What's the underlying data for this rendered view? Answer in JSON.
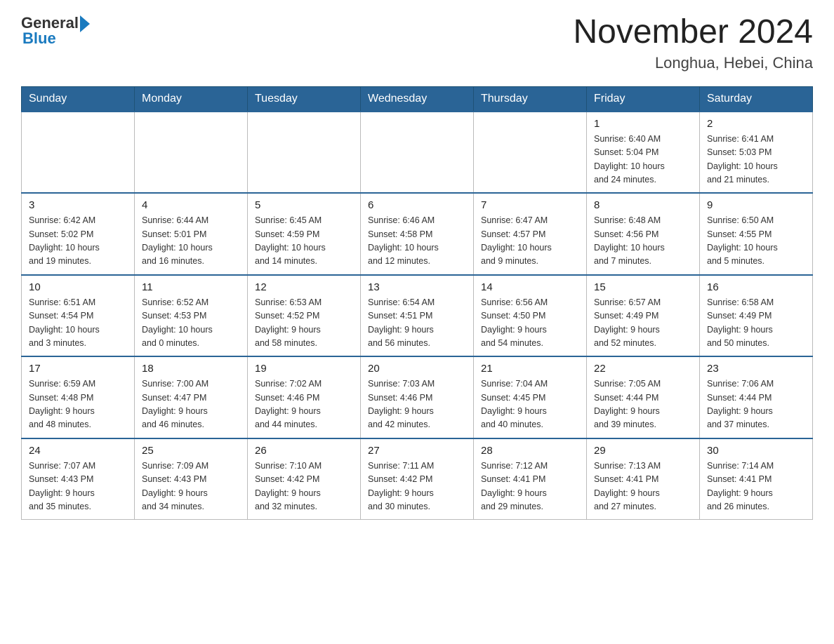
{
  "header": {
    "logo_general": "General",
    "logo_blue": "Blue",
    "month_title": "November 2024",
    "location": "Longhua, Hebei, China"
  },
  "weekdays": [
    "Sunday",
    "Monday",
    "Tuesday",
    "Wednesday",
    "Thursday",
    "Friday",
    "Saturday"
  ],
  "weeks": [
    [
      {
        "day": "",
        "info": ""
      },
      {
        "day": "",
        "info": ""
      },
      {
        "day": "",
        "info": ""
      },
      {
        "day": "",
        "info": ""
      },
      {
        "day": "",
        "info": ""
      },
      {
        "day": "1",
        "info": "Sunrise: 6:40 AM\nSunset: 5:04 PM\nDaylight: 10 hours\nand 24 minutes."
      },
      {
        "day": "2",
        "info": "Sunrise: 6:41 AM\nSunset: 5:03 PM\nDaylight: 10 hours\nand 21 minutes."
      }
    ],
    [
      {
        "day": "3",
        "info": "Sunrise: 6:42 AM\nSunset: 5:02 PM\nDaylight: 10 hours\nand 19 minutes."
      },
      {
        "day": "4",
        "info": "Sunrise: 6:44 AM\nSunset: 5:01 PM\nDaylight: 10 hours\nand 16 minutes."
      },
      {
        "day": "5",
        "info": "Sunrise: 6:45 AM\nSunset: 4:59 PM\nDaylight: 10 hours\nand 14 minutes."
      },
      {
        "day": "6",
        "info": "Sunrise: 6:46 AM\nSunset: 4:58 PM\nDaylight: 10 hours\nand 12 minutes."
      },
      {
        "day": "7",
        "info": "Sunrise: 6:47 AM\nSunset: 4:57 PM\nDaylight: 10 hours\nand 9 minutes."
      },
      {
        "day": "8",
        "info": "Sunrise: 6:48 AM\nSunset: 4:56 PM\nDaylight: 10 hours\nand 7 minutes."
      },
      {
        "day": "9",
        "info": "Sunrise: 6:50 AM\nSunset: 4:55 PM\nDaylight: 10 hours\nand 5 minutes."
      }
    ],
    [
      {
        "day": "10",
        "info": "Sunrise: 6:51 AM\nSunset: 4:54 PM\nDaylight: 10 hours\nand 3 minutes."
      },
      {
        "day": "11",
        "info": "Sunrise: 6:52 AM\nSunset: 4:53 PM\nDaylight: 10 hours\nand 0 minutes."
      },
      {
        "day": "12",
        "info": "Sunrise: 6:53 AM\nSunset: 4:52 PM\nDaylight: 9 hours\nand 58 minutes."
      },
      {
        "day": "13",
        "info": "Sunrise: 6:54 AM\nSunset: 4:51 PM\nDaylight: 9 hours\nand 56 minutes."
      },
      {
        "day": "14",
        "info": "Sunrise: 6:56 AM\nSunset: 4:50 PM\nDaylight: 9 hours\nand 54 minutes."
      },
      {
        "day": "15",
        "info": "Sunrise: 6:57 AM\nSunset: 4:49 PM\nDaylight: 9 hours\nand 52 minutes."
      },
      {
        "day": "16",
        "info": "Sunrise: 6:58 AM\nSunset: 4:49 PM\nDaylight: 9 hours\nand 50 minutes."
      }
    ],
    [
      {
        "day": "17",
        "info": "Sunrise: 6:59 AM\nSunset: 4:48 PM\nDaylight: 9 hours\nand 48 minutes."
      },
      {
        "day": "18",
        "info": "Sunrise: 7:00 AM\nSunset: 4:47 PM\nDaylight: 9 hours\nand 46 minutes."
      },
      {
        "day": "19",
        "info": "Sunrise: 7:02 AM\nSunset: 4:46 PM\nDaylight: 9 hours\nand 44 minutes."
      },
      {
        "day": "20",
        "info": "Sunrise: 7:03 AM\nSunset: 4:46 PM\nDaylight: 9 hours\nand 42 minutes."
      },
      {
        "day": "21",
        "info": "Sunrise: 7:04 AM\nSunset: 4:45 PM\nDaylight: 9 hours\nand 40 minutes."
      },
      {
        "day": "22",
        "info": "Sunrise: 7:05 AM\nSunset: 4:44 PM\nDaylight: 9 hours\nand 39 minutes."
      },
      {
        "day": "23",
        "info": "Sunrise: 7:06 AM\nSunset: 4:44 PM\nDaylight: 9 hours\nand 37 minutes."
      }
    ],
    [
      {
        "day": "24",
        "info": "Sunrise: 7:07 AM\nSunset: 4:43 PM\nDaylight: 9 hours\nand 35 minutes."
      },
      {
        "day": "25",
        "info": "Sunrise: 7:09 AM\nSunset: 4:43 PM\nDaylight: 9 hours\nand 34 minutes."
      },
      {
        "day": "26",
        "info": "Sunrise: 7:10 AM\nSunset: 4:42 PM\nDaylight: 9 hours\nand 32 minutes."
      },
      {
        "day": "27",
        "info": "Sunrise: 7:11 AM\nSunset: 4:42 PM\nDaylight: 9 hours\nand 30 minutes."
      },
      {
        "day": "28",
        "info": "Sunrise: 7:12 AM\nSunset: 4:41 PM\nDaylight: 9 hours\nand 29 minutes."
      },
      {
        "day": "29",
        "info": "Sunrise: 7:13 AM\nSunset: 4:41 PM\nDaylight: 9 hours\nand 27 minutes."
      },
      {
        "day": "30",
        "info": "Sunrise: 7:14 AM\nSunset: 4:41 PM\nDaylight: 9 hours\nand 26 minutes."
      }
    ]
  ]
}
